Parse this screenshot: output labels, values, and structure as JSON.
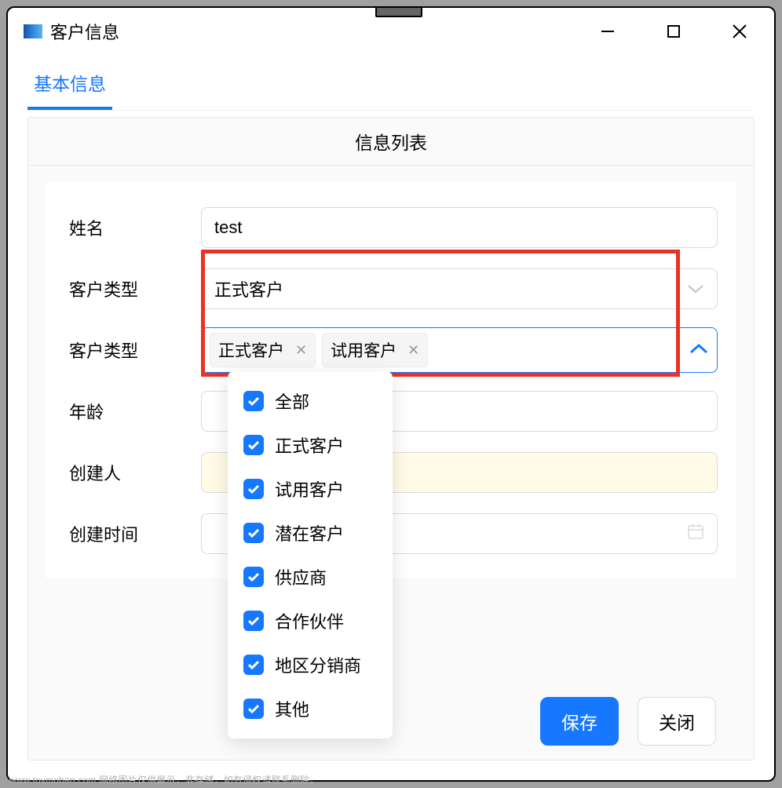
{
  "window": {
    "title": "客户信息"
  },
  "tab": {
    "label": "基本信息"
  },
  "panel": {
    "header": "信息列表"
  },
  "form": {
    "name": {
      "label": "姓名",
      "value": "test"
    },
    "type_single": {
      "label": "客户类型",
      "value": "正式客户"
    },
    "type_multi": {
      "label": "客户类型",
      "tags": [
        {
          "label": "正式客户"
        },
        {
          "label": "试用客户"
        }
      ]
    },
    "age": {
      "label": "年龄"
    },
    "creator": {
      "label": "创建人"
    },
    "created_at": {
      "label": "创建时间"
    }
  },
  "dropdown": {
    "options": [
      {
        "label": "全部",
        "checked": true
      },
      {
        "label": "正式客户",
        "checked": true
      },
      {
        "label": "试用客户",
        "checked": true
      },
      {
        "label": "潜在客户",
        "checked": true
      },
      {
        "label": "供应商",
        "checked": true
      },
      {
        "label": "合作伙伴",
        "checked": true
      },
      {
        "label": "地区分销商",
        "checked": true
      },
      {
        "label": "其他",
        "checked": true
      }
    ]
  },
  "footer": {
    "save": "保存",
    "close": "关闭"
  },
  "watermark": "www.toymoban.com 网络图片仅供展示，非存储，如有侵权请联系删除。"
}
